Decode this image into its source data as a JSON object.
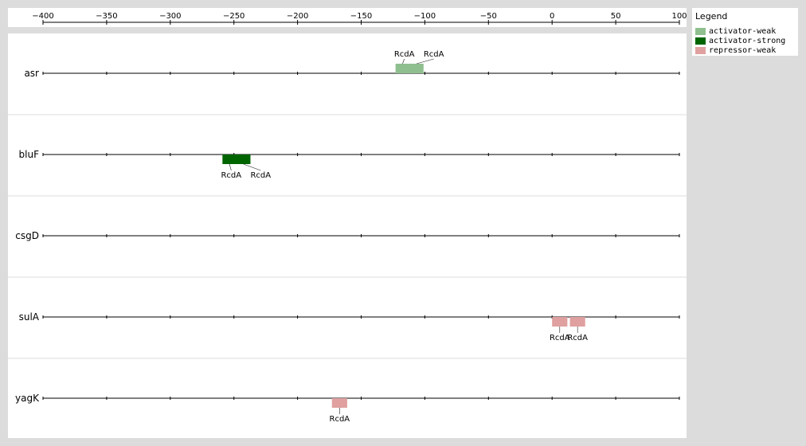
{
  "axis": {
    "min": -400,
    "max": 100,
    "ticks": [
      -400,
      -350,
      -300,
      -250,
      -200,
      -150,
      -100,
      -50,
      0,
      50,
      100
    ],
    "tick_labels": [
      "−400",
      "−350",
      "−300",
      "−250",
      "−200",
      "−150",
      "−100",
      "−50",
      "0",
      "50",
      "100"
    ]
  },
  "legend": {
    "title": "Legend",
    "items": [
      {
        "label": "activator-weak",
        "type": "activator-weak",
        "color": "#8fbf8f"
      },
      {
        "label": "activator-strong",
        "type": "activator-strong",
        "color": "#006400"
      },
      {
        "label": "repressor-weak",
        "type": "repressor-weak",
        "color": "#e0a0a0"
      }
    ]
  },
  "genes": [
    {
      "name": "asr",
      "sites": [
        {
          "start": -123,
          "end": -101,
          "type": "activator-weak",
          "labels": [
            "RcdA",
            "RcdA"
          ],
          "label_side": "above"
        }
      ]
    },
    {
      "name": "bluF",
      "sites": [
        {
          "start": -259,
          "end": -237,
          "type": "activator-strong",
          "labels": [
            "RcdA",
            "RcdA"
          ],
          "label_side": "below"
        }
      ]
    },
    {
      "name": "csgD",
      "sites": []
    },
    {
      "name": "sulA",
      "sites": [
        {
          "start": 0,
          "end": 12,
          "type": "repressor-weak",
          "labels": [
            "RcdA"
          ],
          "label_side": "below"
        },
        {
          "start": 14,
          "end": 26,
          "type": "repressor-weak",
          "labels": [
            "RcdA"
          ],
          "label_side": "below"
        }
      ]
    },
    {
      "name": "yagK",
      "sites": [
        {
          "start": -173,
          "end": -161,
          "type": "repressor-weak",
          "labels": [
            "RcdA"
          ],
          "label_side": "below"
        }
      ]
    }
  ]
}
